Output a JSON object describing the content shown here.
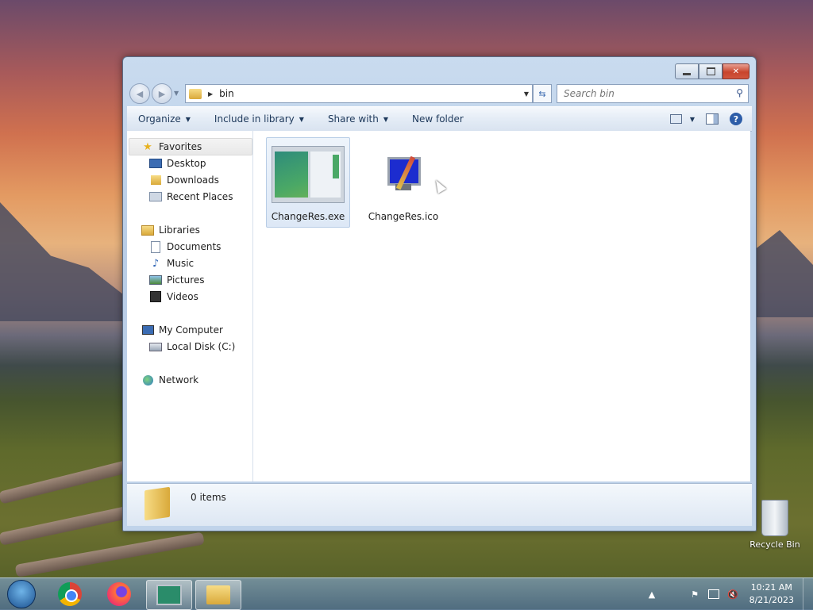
{
  "window": {
    "caption_buttons": {
      "minimize": "minimize-icon",
      "maximize": "maximize-icon",
      "close": "close-icon"
    }
  },
  "address_bar": {
    "path": "bin"
  },
  "search": {
    "placeholder": "Search bin"
  },
  "toolbar": {
    "organize": "Organize",
    "include_in_library": "Include in library",
    "share_with": "Share with",
    "new_folder": "New folder"
  },
  "nav": {
    "favorites": "Favorites",
    "desktop": "Desktop",
    "downloads": "Downloads",
    "recent_places": "Recent Places",
    "libraries": "Libraries",
    "documents": "Documents",
    "music": "Music",
    "pictures": "Pictures",
    "videos": "Videos",
    "my_computer": "My Computer",
    "local_disk": "Local Disk (C:)",
    "network": "Network"
  },
  "files": [
    {
      "name": "ChangeRes.exe",
      "selected": true
    },
    {
      "name": "ChangeRes.ico",
      "selected": false
    }
  ],
  "details": {
    "count": "0 items"
  },
  "desktop": {
    "recycle_bin": "Recycle Bin"
  },
  "taskbar": {
    "time": "10:21 AM",
    "date": "8/21/2023"
  },
  "colors": {
    "accent": "#1e395b",
    "selection": "#dde8f6",
    "close_button": "#c8442c"
  }
}
